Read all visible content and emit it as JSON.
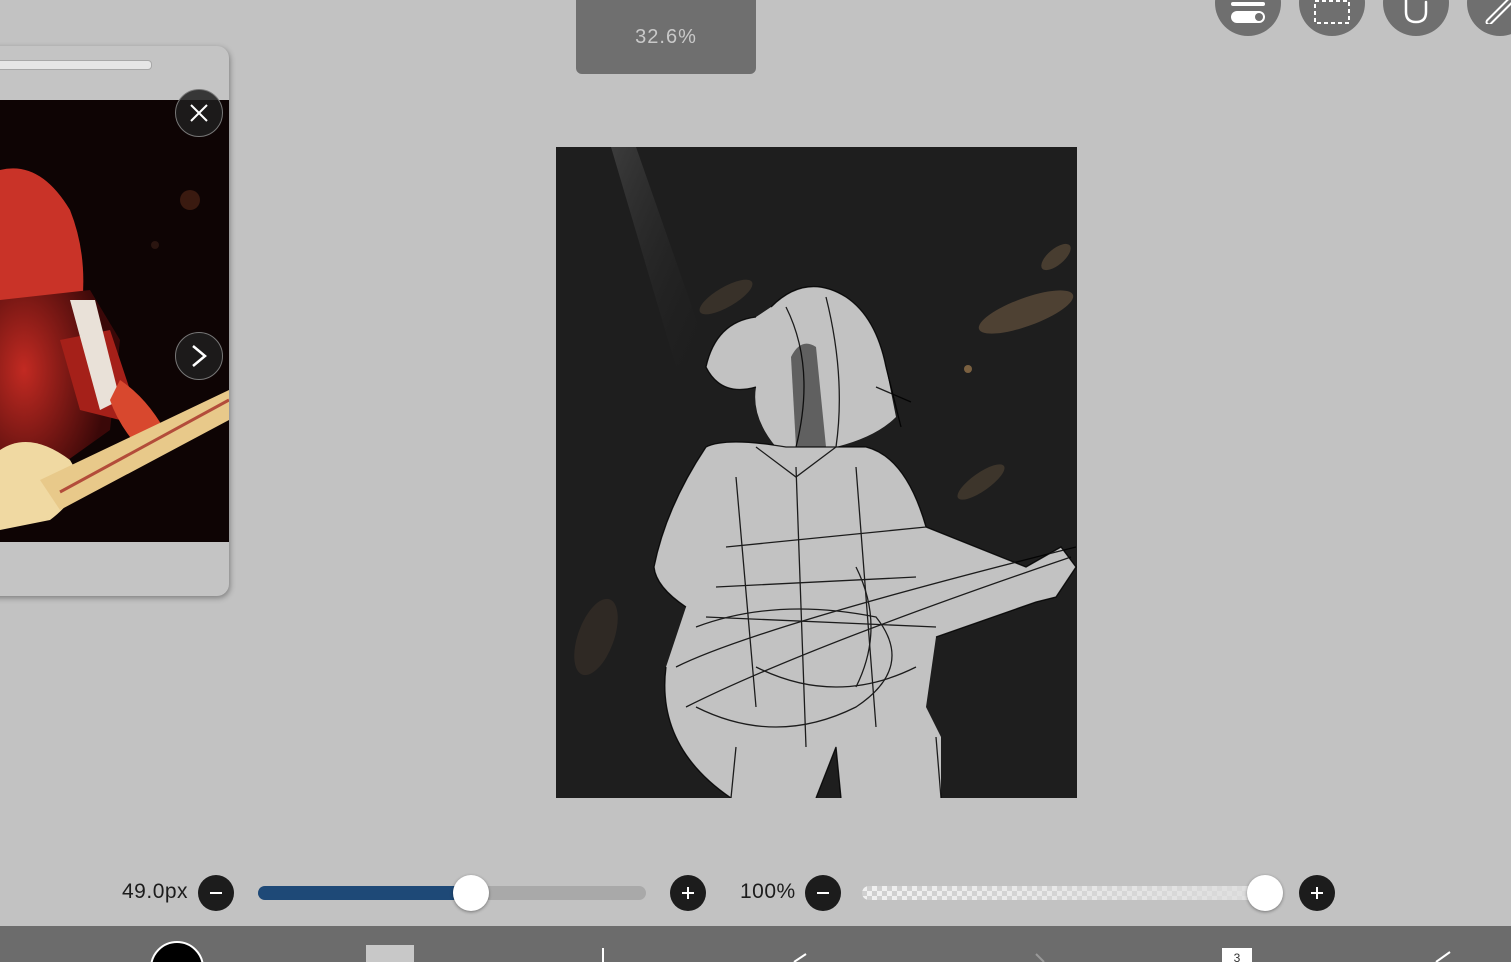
{
  "zoom": {
    "value": "32.6%"
  },
  "top_tools": [
    {
      "name": "layer-toggle"
    },
    {
      "name": "selection"
    },
    {
      "name": "hand"
    },
    {
      "name": "ruler"
    }
  ],
  "reference_window": {
    "close_icon": "close-icon",
    "next_icon": "chevron-right-icon"
  },
  "brush": {
    "size_label": "49.0px",
    "size_fraction": 0.55,
    "opacity_label": "100%",
    "opacity_fraction": 1.0
  },
  "colors": {
    "accent": "#1e4977",
    "background": "#c2c2c2",
    "canvas": "#1e1e1e",
    "toolbar": "#6c6c6c",
    "primary_color": "#000000",
    "secondary_color": "#c8c8c8"
  },
  "bottom_toolbar": {
    "layers_count": "3"
  }
}
